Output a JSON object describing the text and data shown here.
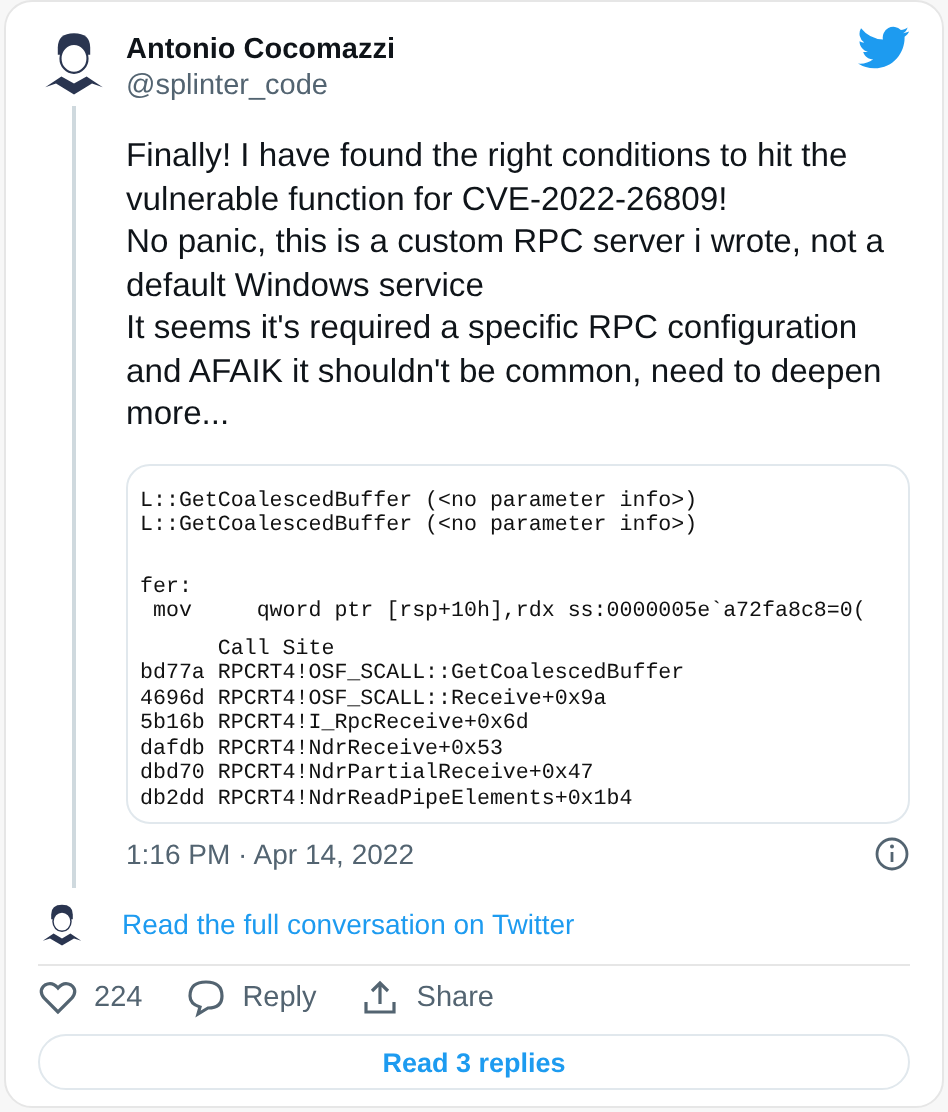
{
  "author": {
    "name": "Antonio Cocomazzi",
    "handle": "@splinter_code"
  },
  "tweet_paragraphs": [
    "Finally! I have found the right conditions to hit the vulnerable function for CVE-2022-26809!",
    "No panic, this is a custom RPC server i wrote, not a default Windows service",
    "It seems it's required a specific RPC configuration and AFAIK it shouldn't be common, need to deepen more..."
  ],
  "debugger_blocks": [
    [
      "L::GetCoalescedBuffer (<no parameter info>)",
      "L::GetCoalescedBuffer (<no parameter info>)"
    ],
    [
      "fer:",
      " mov     qword ptr [rsp+10h],rdx ss:0000005e`a72fa8c8=0("
    ],
    [
      "      Call Site",
      "bd77a RPCRT4!OSF_SCALL::GetCoalescedBuffer",
      "4696d RPCRT4!OSF_SCALL::Receive+0x9a",
      "5b16b RPCRT4!I_RpcReceive+0x6d",
      "dafdb RPCRT4!NdrReceive+0x53",
      "dbd70 RPCRT4!NdrPartialReceive+0x47",
      "db2dd RPCRT4!NdrReadPipeElements+0x1b4"
    ]
  ],
  "timestamp": "1:16 PM · Apr 14, 2022",
  "conversation_link": "Read the full conversation on Twitter",
  "actions": [
    {
      "kind": "like",
      "label": "224"
    },
    {
      "kind": "reply",
      "label": "Reply"
    },
    {
      "kind": "share",
      "label": "Share"
    }
  ],
  "replies_button": "Read 3 replies"
}
